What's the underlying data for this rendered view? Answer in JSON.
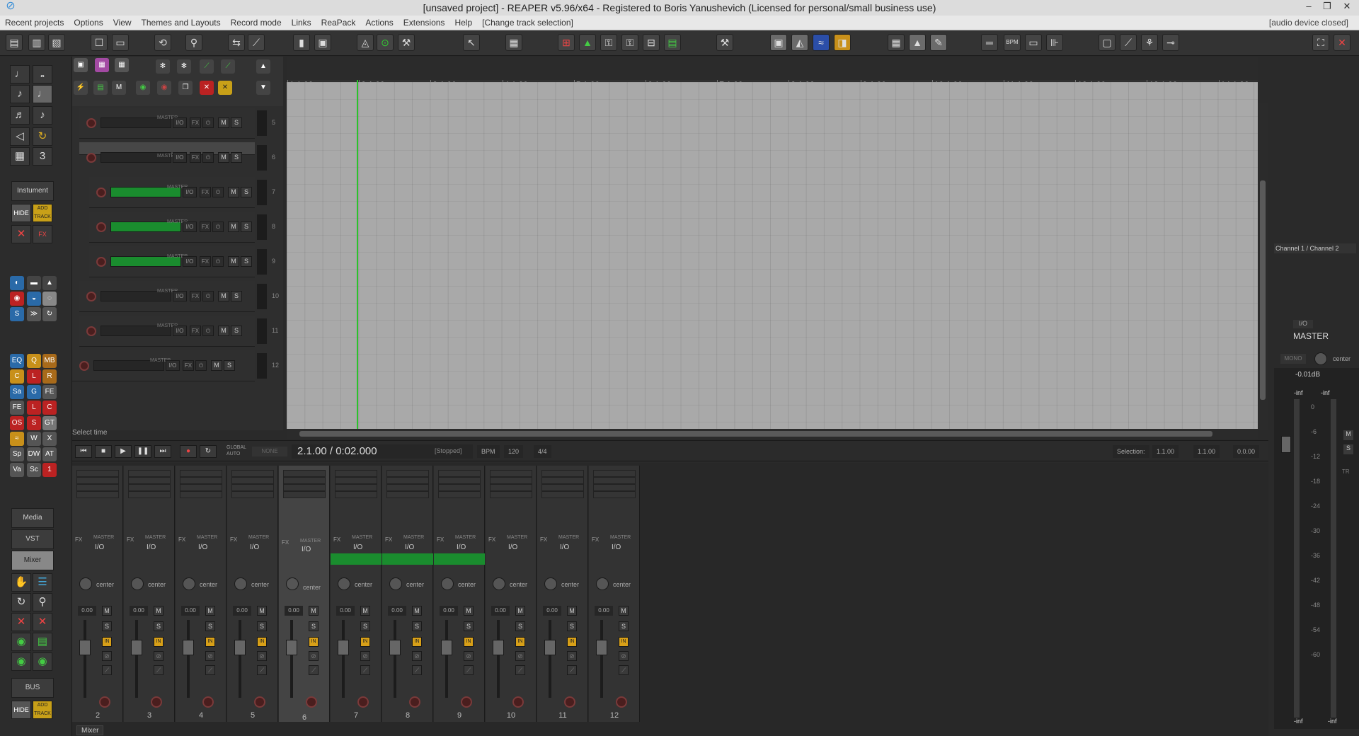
{
  "title": "[unsaved project] - REAPER v5.96/x64 - Registered to Boris Yanushevich (Licensed for personal/small business use)",
  "menu": [
    "Recent projects",
    "Options",
    "View",
    "Themes and Layouts",
    "Record mode",
    "Links",
    "ReaPack",
    "Actions",
    "Extensions",
    "Help",
    "[Change track selection]"
  ],
  "menu_right": "[audio device closed]",
  "left_labels": {
    "instrument": "Instument",
    "hide": "HIDE",
    "add_track": "ADD TRACK",
    "fx": "FX",
    "media": "Media",
    "vst": "VST",
    "mixer": "Mixer",
    "bus": "BUS",
    "hide2": "HIDE",
    "add_track2": "ADD TRACK"
  },
  "ruler": {
    "bars": [
      "1.1.00",
      "2.1.00",
      "3.1.00",
      "4.1.00",
      "5.1.00",
      "6.1.00",
      "7.1.00",
      "8.1.00",
      "9.1.00",
      "10.1.00",
      "11.1.00",
      "12.1.00",
      "13.1.00",
      "14.1.00"
    ],
    "times": [
      "0:00.000",
      "0:02.000",
      "0:04.000",
      "0:06.000",
      "0:08.000",
      "0:10.000",
      "0:12.000",
      "0:14.000",
      "0:16.000",
      "0:18.000",
      "0:20.000",
      "0:22.000",
      "0:24.000",
      "0:26.000"
    ]
  },
  "tracks": [
    {
      "num": "5",
      "indent": 1,
      "green": false,
      "selected": false,
      "master": "MASTER",
      "io": "I/O",
      "fx": "FX",
      "m": "M",
      "s": "S"
    },
    {
      "num": "6",
      "indent": 1,
      "green": false,
      "selected": true,
      "master": "MASTER",
      "io": "I/O",
      "fx": "FX",
      "m": "M",
      "s": "S"
    },
    {
      "num": "7",
      "indent": 2,
      "green": true,
      "selected": false,
      "master": "MASTER",
      "io": "I/O",
      "fx": "FX",
      "m": "M",
      "s": "S"
    },
    {
      "num": "8",
      "indent": 2,
      "green": true,
      "selected": false,
      "master": "MASTER",
      "io": "I/O",
      "fx": "FX",
      "m": "M",
      "s": "S"
    },
    {
      "num": "9",
      "indent": 2,
      "green": true,
      "selected": false,
      "master": "MASTER",
      "io": "I/O",
      "fx": "FX",
      "m": "M",
      "s": "S"
    },
    {
      "num": "10",
      "indent": 1,
      "green": false,
      "selected": false,
      "master": "MASTER",
      "io": "I/O",
      "fx": "FX",
      "m": "M",
      "s": "S"
    },
    {
      "num": "11",
      "indent": 1,
      "green": false,
      "selected": false,
      "master": "MASTER",
      "io": "I/O",
      "fx": "FX",
      "m": "M",
      "s": "S"
    },
    {
      "num": "12",
      "indent": 0,
      "green": false,
      "selected": false,
      "master": "MASTER",
      "io": "I/O",
      "fx": "FX",
      "m": "M",
      "s": "S"
    }
  ],
  "status": "Select time",
  "transport": {
    "global_auto": "GLOBAL AUTO",
    "auto_mode": "NONE",
    "time": "2.1.00 / 0:02.000",
    "state": "[Stopped]",
    "bpm_label": "BPM",
    "bpm": "120",
    "sig": "4/4",
    "selection_label": "Selection:",
    "sel_start": "1.1.00",
    "sel_end": "1.1.00",
    "sel_len": "0.0.00"
  },
  "mixer": {
    "tab": "Mixer",
    "strips": [
      {
        "num": "2",
        "green": false,
        "sel": false
      },
      {
        "num": "3",
        "green": false,
        "sel": false
      },
      {
        "num": "4",
        "green": false,
        "sel": false
      },
      {
        "num": "5",
        "green": false,
        "sel": false
      },
      {
        "num": "6",
        "green": false,
        "sel": true
      },
      {
        "num": "7",
        "green": true,
        "sel": false
      },
      {
        "num": "8",
        "green": true,
        "sel": false
      },
      {
        "num": "9",
        "green": true,
        "sel": false
      },
      {
        "num": "10",
        "green": false,
        "sel": false
      },
      {
        "num": "11",
        "green": false,
        "sel": false
      },
      {
        "num": "12",
        "green": false,
        "sel": false
      }
    ],
    "strip_labels": {
      "master": "MASTER",
      "io": "I/O",
      "fx": "FX",
      "pan": "center",
      "vol": "0.00",
      "m": "M",
      "s": "S",
      "in": "IN"
    }
  },
  "master": {
    "channel": "Channel 1 / Channel 2",
    "io": "I/O",
    "name": "MASTER",
    "mono": "MONO",
    "pan": "center",
    "vol": "-0.01dB",
    "peak_l": "-inf",
    "peak_r": "-inf",
    "scale": [
      "0",
      "-6",
      "-12",
      "-18",
      "-24",
      "-30",
      "-36",
      "-42",
      "-48",
      "-54",
      "-60"
    ],
    "bottom_l": "-inf",
    "bottom_r": "-inf",
    "m": "M",
    "s": "S",
    "tr": "TR"
  }
}
